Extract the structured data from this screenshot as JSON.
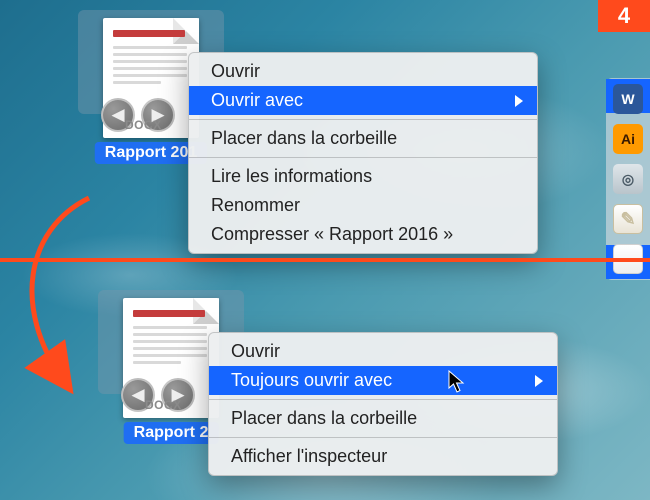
{
  "step_number": "4",
  "file": {
    "label_top": "Rapport 201",
    "label_bottom": "Rapport 2",
    "ext_badge": "DOCX"
  },
  "context_menu_top": {
    "open": "Ouvrir",
    "open_with": "Ouvrir avec",
    "trash": "Placer dans la corbeille",
    "info": "Lire les informations",
    "rename": "Renommer",
    "compress": "Compresser « Rapport 2016 »"
  },
  "context_menu_bottom": {
    "open": "Ouvrir",
    "always_open_with": "Toujours ouvrir avec",
    "trash": "Placer dans la corbeille",
    "show_inspector": "Afficher l'inspecteur"
  },
  "dock_apps": {
    "word": "W",
    "illustrator": "Ai",
    "preview": "◎",
    "textedit": "✎",
    "blank": ""
  }
}
